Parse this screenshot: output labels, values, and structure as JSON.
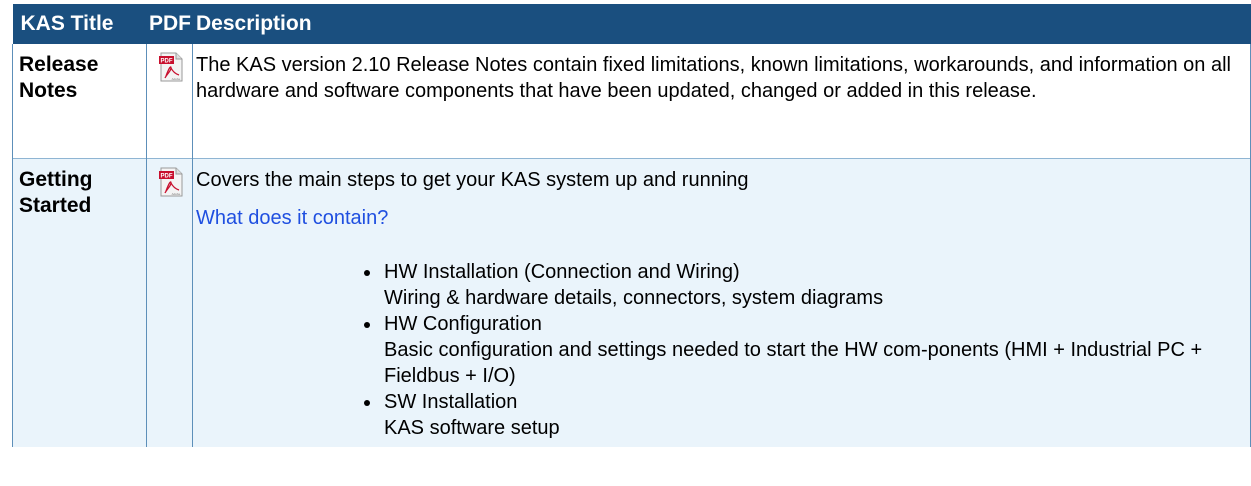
{
  "table": {
    "headers": {
      "title": "KAS Title",
      "pdf": "PDF",
      "description": "Description"
    },
    "rows": [
      {
        "title": "Release Notes",
        "pdf_icon": "pdf-adobe-icon",
        "description": "The KAS version 2.10 Release Notes contain fixed limitations, known limitations, workarounds, and information on all hardware and software components that have been updated, changed or added in this release."
      },
      {
        "title": "Getting Started",
        "pdf_icon": "pdf-adobe-icon",
        "description": "Covers the main steps to get your KAS system up and running",
        "link": "What does it contain?",
        "bullets": [
          {
            "title": "HW Installation (Connection and Wiring)",
            "detail": "Wiring & hardware details, connectors, system diagrams"
          },
          {
            "title": "HW Configuration",
            "detail": "Basic configuration and settings needed to start the HW com-ponents (HMI + Industrial PC + Fieldbus + I/O)"
          },
          {
            "title": "SW Installation",
            "detail": "KAS software setup"
          }
        ]
      }
    ]
  },
  "colors": {
    "header_bg": "#1a4f7f",
    "row_alt_bg": "#eaf4fb",
    "link": "#1f4fe0"
  }
}
